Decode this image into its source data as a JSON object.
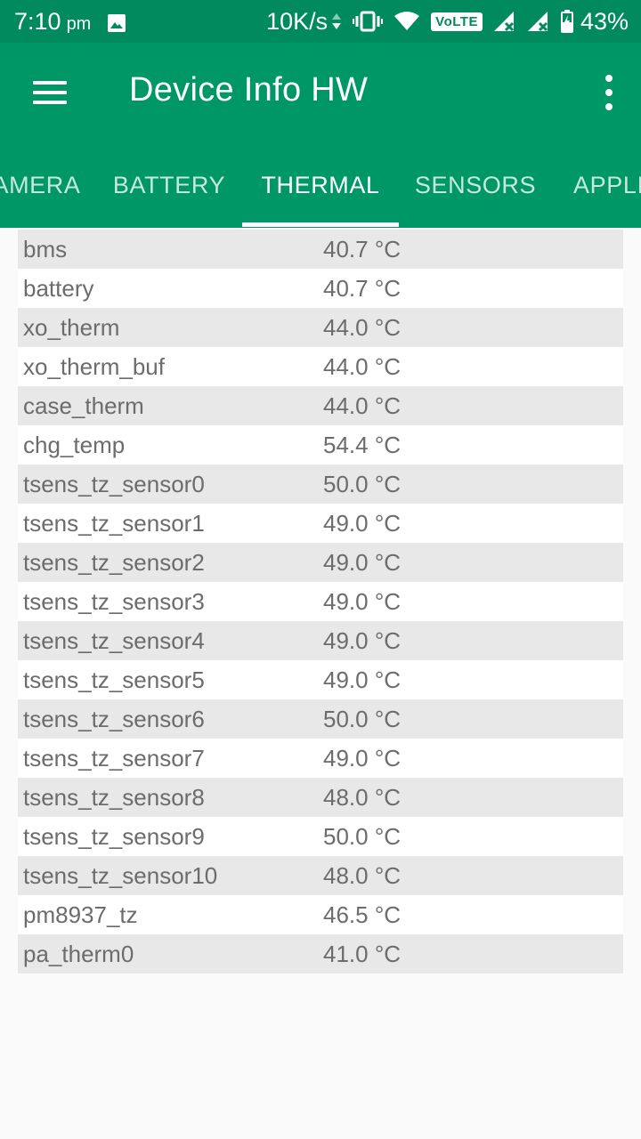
{
  "status_bar": {
    "time": "7:10",
    "ampm": "pm",
    "network_speed": "10K/s",
    "volte": "VoLTE",
    "battery_percent": "43%",
    "icons": [
      "gallery-icon",
      "data-arrows-icon",
      "vibrate-icon",
      "wifi-icon",
      "volte-icon",
      "signal-icon",
      "signal-icon",
      "battery-charging-icon"
    ]
  },
  "app_bar": {
    "title": "Device Info HW",
    "menu_icon": "hamburger-menu-icon",
    "overflow_icon": "more-vert-icon"
  },
  "tabs": [
    {
      "label": "AMERA"
    },
    {
      "label": "BATTERY"
    },
    {
      "label": "THERMAL",
      "active": true
    },
    {
      "label": "SENSORS"
    },
    {
      "label": "APPLI"
    }
  ],
  "thermal_rows": [
    {
      "name": "bms",
      "value": "40.7 °C"
    },
    {
      "name": "battery",
      "value": "40.7 °C"
    },
    {
      "name": "xo_therm",
      "value": "44.0 °C"
    },
    {
      "name": "xo_therm_buf",
      "value": "44.0 °C"
    },
    {
      "name": "case_therm",
      "value": "44.0 °C"
    },
    {
      "name": "chg_temp",
      "value": "54.4 °C"
    },
    {
      "name": "tsens_tz_sensor0",
      "value": "50.0 °C"
    },
    {
      "name": "tsens_tz_sensor1",
      "value": "49.0 °C"
    },
    {
      "name": "tsens_tz_sensor2",
      "value": "49.0 °C"
    },
    {
      "name": "tsens_tz_sensor3",
      "value": "49.0 °C"
    },
    {
      "name": "tsens_tz_sensor4",
      "value": "49.0 °C"
    },
    {
      "name": "tsens_tz_sensor5",
      "value": "49.0 °C"
    },
    {
      "name": "tsens_tz_sensor6",
      "value": "50.0 °C"
    },
    {
      "name": "tsens_tz_sensor7",
      "value": "49.0 °C"
    },
    {
      "name": "tsens_tz_sensor8",
      "value": "48.0 °C"
    },
    {
      "name": "tsens_tz_sensor9",
      "value": "50.0 °C"
    },
    {
      "name": "tsens_tz_sensor10",
      "value": "48.0 °C"
    },
    {
      "name": "pm8937_tz",
      "value": "46.5 °C"
    },
    {
      "name": "pa_therm0",
      "value": "41.0 °C"
    }
  ],
  "colors": {
    "status_bar": "#008a5e",
    "app_bar": "#009767",
    "row_odd": "#e8e8e8",
    "row_even": "#ffffff",
    "text": "#6c6c6c"
  }
}
